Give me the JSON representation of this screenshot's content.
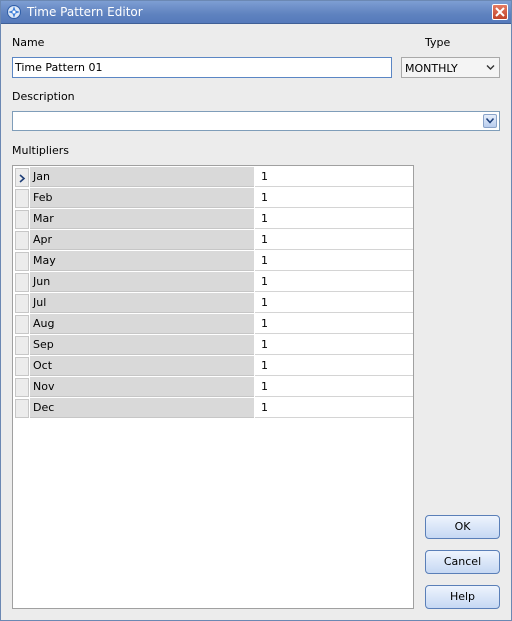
{
  "window": {
    "title": "Time Pattern Editor"
  },
  "form": {
    "name_label": "Name",
    "name_value": "Time Pattern 01",
    "type_label": "Type",
    "type_value": "MONTHLY",
    "description_label": "Description",
    "description_value": "",
    "multipliers_label": "Multipliers"
  },
  "multipliers": [
    {
      "month": "Jan",
      "value": "1"
    },
    {
      "month": "Feb",
      "value": "1"
    },
    {
      "month": "Mar",
      "value": "1"
    },
    {
      "month": "Apr",
      "value": "1"
    },
    {
      "month": "May",
      "value": "1"
    },
    {
      "month": "Jun",
      "value": "1"
    },
    {
      "month": "Jul",
      "value": "1"
    },
    {
      "month": "Aug",
      "value": "1"
    },
    {
      "month": "Sep",
      "value": "1"
    },
    {
      "month": "Oct",
      "value": "1"
    },
    {
      "month": "Nov",
      "value": "1"
    },
    {
      "month": "Dec",
      "value": "1"
    }
  ],
  "buttons": {
    "ok": "OK",
    "cancel": "Cancel",
    "help": "Help"
  },
  "icons": {
    "app": "time-pattern-icon",
    "close": "close-icon",
    "type_dropdown": "chevron-down-icon",
    "description_dropdown": "chevron-down-icon",
    "current_row": "row-pointer-icon"
  },
  "colors": {
    "titlebar": "#5f82bf",
    "input_border": "#5b86c4",
    "close": "#c0442a"
  }
}
